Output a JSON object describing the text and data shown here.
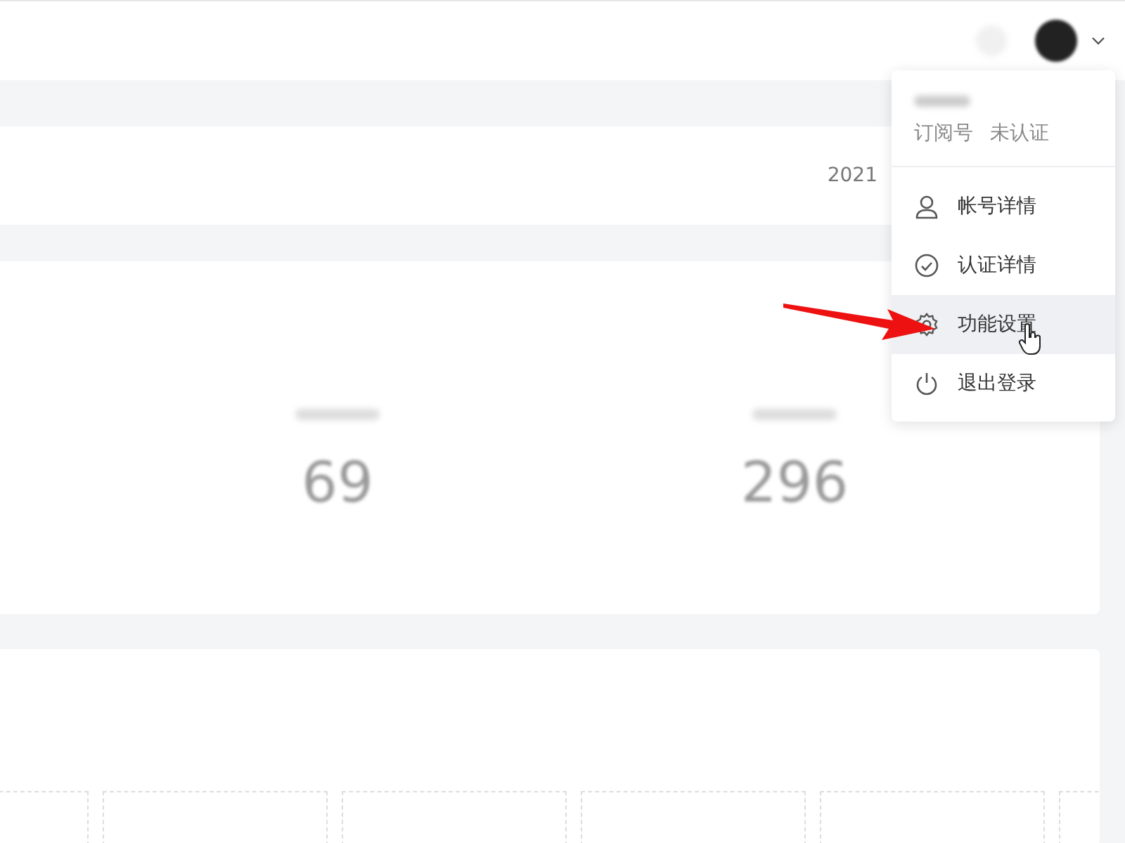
{
  "overview": {
    "date": "2021"
  },
  "stats": [
    {
      "value": "69"
    },
    {
      "value": "296"
    }
  ],
  "menu": {
    "account_type": "订阅号",
    "verification": "未认证",
    "items": [
      {
        "kind": "user",
        "label": "帐号详情",
        "hovered": false
      },
      {
        "kind": "check",
        "label": "认证详情",
        "hovered": false
      },
      {
        "kind": "gear",
        "label": "功能设置",
        "hovered": true
      },
      {
        "kind": "power",
        "label": "退出登录",
        "hovered": false
      }
    ]
  }
}
